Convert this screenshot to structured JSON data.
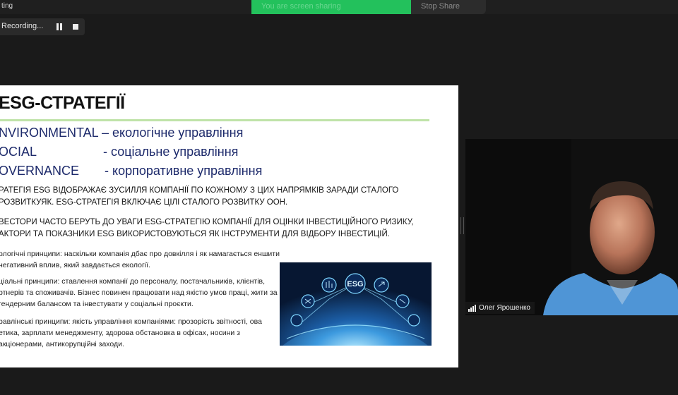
{
  "window": {
    "title": "ting"
  },
  "share_banner": {
    "text": "You are screen sharing",
    "stop_label": "Stop Share"
  },
  "recording": {
    "label": "Recording..."
  },
  "slide": {
    "title": "ESG-СТРАТЕГІЇ",
    "esg_rows": [
      {
        "key": "NVIRONMENTAL",
        "value": "– екологічне управління"
      },
      {
        "key": "OCIAL",
        "value": "- соціальне управління"
      },
      {
        "key": "OVERNANCE",
        "value": "- корпоративне управління"
      }
    ],
    "paragraph1": "ратегія ESG відображає зусилля компанії по кожному з цих напрямків заради сталого розвиткуяк. ESG-стратегія включає цілі сталого розвитку ООН.",
    "paragraph2": "вестори часто беруть до уваги ESG-стратегію компанії для оцінки інвестиційного ризику, актори та показники ESG використовуються як інструменти для відбору інвестицій.",
    "principles": [
      "ологічні принципи: наскільки компанія дбає про довкілля і як намагається еншити негативний вплив, який завдається екології.",
      "ціальні принципи: ставлення компанії до персоналу, постачальників, клієнтів, ртнерів та споживачів. Бізнес повинен працювати над якістю умов праці, жити за гендерним балансом та інвестувати у соціальні проєкти.",
      "равлінські принципи: якість управління компаніями: прозорість звітності, ова етика, зарплати менеджменту, здорова обстановка в офісах, носини з акціонерами, антикорупційні заходи."
    ],
    "image_label": "ESG"
  },
  "video": {
    "participant_name": "Олег Ярошенко"
  }
}
